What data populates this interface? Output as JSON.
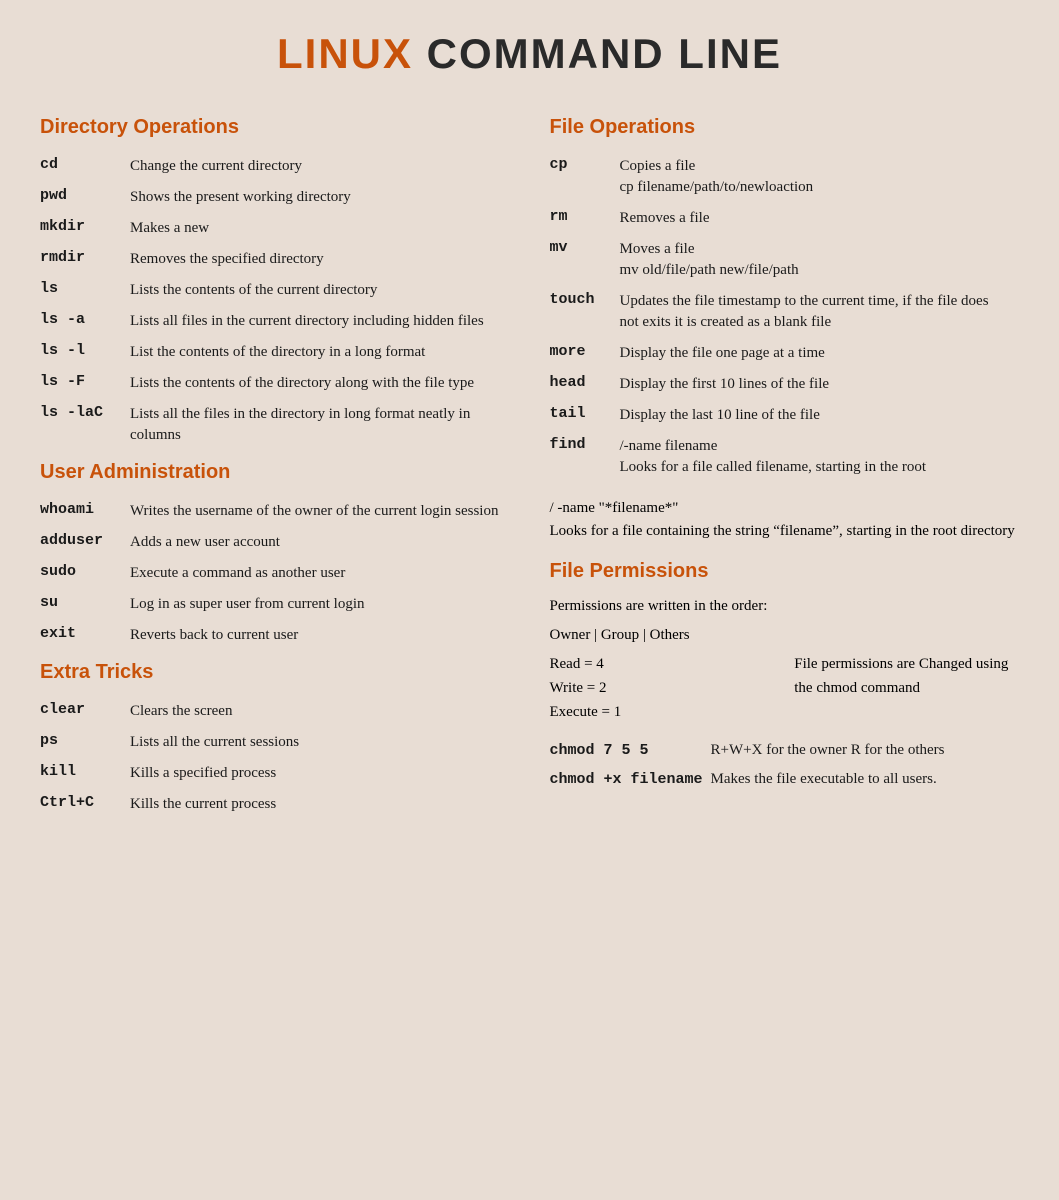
{
  "title": {
    "linux": "LINUX",
    "rest": " COMMAND LINE"
  },
  "left": {
    "directory": {
      "heading": "Directory Operations",
      "commands": [
        {
          "cmd": "cd",
          "desc": "Change the current directory"
        },
        {
          "cmd": "pwd",
          "desc": "Shows the present working directory"
        },
        {
          "cmd": "mkdir",
          "desc": "Makes a new"
        },
        {
          "cmd": "rmdir",
          "desc": "Removes the specified directory"
        },
        {
          "cmd": "ls",
          "desc": "Lists the contents of the current directory"
        },
        {
          "cmd": "ls -a",
          "desc": "Lists all files in the current directory including hidden files"
        },
        {
          "cmd": "ls -l",
          "desc": "List the contents of the directory in a long format"
        },
        {
          "cmd": "ls -F",
          "desc": "Lists the contents of the directory along with the file type"
        },
        {
          "cmd": "ls -laC",
          "desc": "Lists all the files in the directory in long format neatly in columns"
        }
      ]
    },
    "user": {
      "heading": "User Administration",
      "commands": [
        {
          "cmd": "whoami",
          "desc": "Writes the username of the owner of the current login session"
        },
        {
          "cmd": "adduser",
          "desc": "Adds a new user account"
        },
        {
          "cmd": "sudo",
          "desc": "Execute a command as another user"
        },
        {
          "cmd": "su",
          "desc": "Log in as super user from current login"
        },
        {
          "cmd": "exit",
          "desc": "Reverts back to current user"
        }
      ]
    },
    "extra": {
      "heading": "Extra Tricks",
      "commands": [
        {
          "cmd": "clear",
          "desc": "Clears the screen"
        },
        {
          "cmd": "ps",
          "desc": "Lists all the current sessions"
        },
        {
          "cmd": "kill",
          "desc": "Kills a specified process"
        },
        {
          "cmd": "Ctrl+C",
          "desc": "Kills the current process"
        }
      ]
    }
  },
  "right": {
    "file_ops": {
      "heading": "File Operations",
      "commands": [
        {
          "cmd": "cp",
          "desc": "Copies a file\ncp filename/path/to/newloaction"
        },
        {
          "cmd": "rm",
          "desc": "Removes a file"
        },
        {
          "cmd": "mv",
          "desc": "Moves a file\nmv old/file/path new/file/path"
        },
        {
          "cmd": "touch",
          "desc": "Updates the file timestamp to the current time, if the file does not exits it is created as a blank file"
        },
        {
          "cmd": "more",
          "desc": "Display the file one page at a time"
        },
        {
          "cmd": "head",
          "desc": "Display the first 10 lines of the file"
        },
        {
          "cmd": "tail",
          "desc": "Display the last 10 line of the file"
        },
        {
          "cmd": "find",
          "desc": "/-name filename\nLooks for a file called filename, starting in the root"
        }
      ],
      "find_extra": "/ -name \"*filename*\"\nLooks for a file containing the string “filename”, starting in the root directory"
    },
    "file_perms": {
      "heading": "File Permissions",
      "order_text": "Permissions are written in the order:",
      "owner_group": "Owner | Group | Others",
      "values": [
        "Read = 4",
        "Write = 2",
        "Execute = 1"
      ],
      "changed_text": "File permissions are Changed using the chmod command",
      "chmod_commands": [
        {
          "cmd": "chmod 7 5 5",
          "desc": "R+W+X for the owner R for the others"
        },
        {
          "cmd": "chmod +x filename",
          "desc": "Makes the file executable to all users."
        }
      ]
    }
  }
}
